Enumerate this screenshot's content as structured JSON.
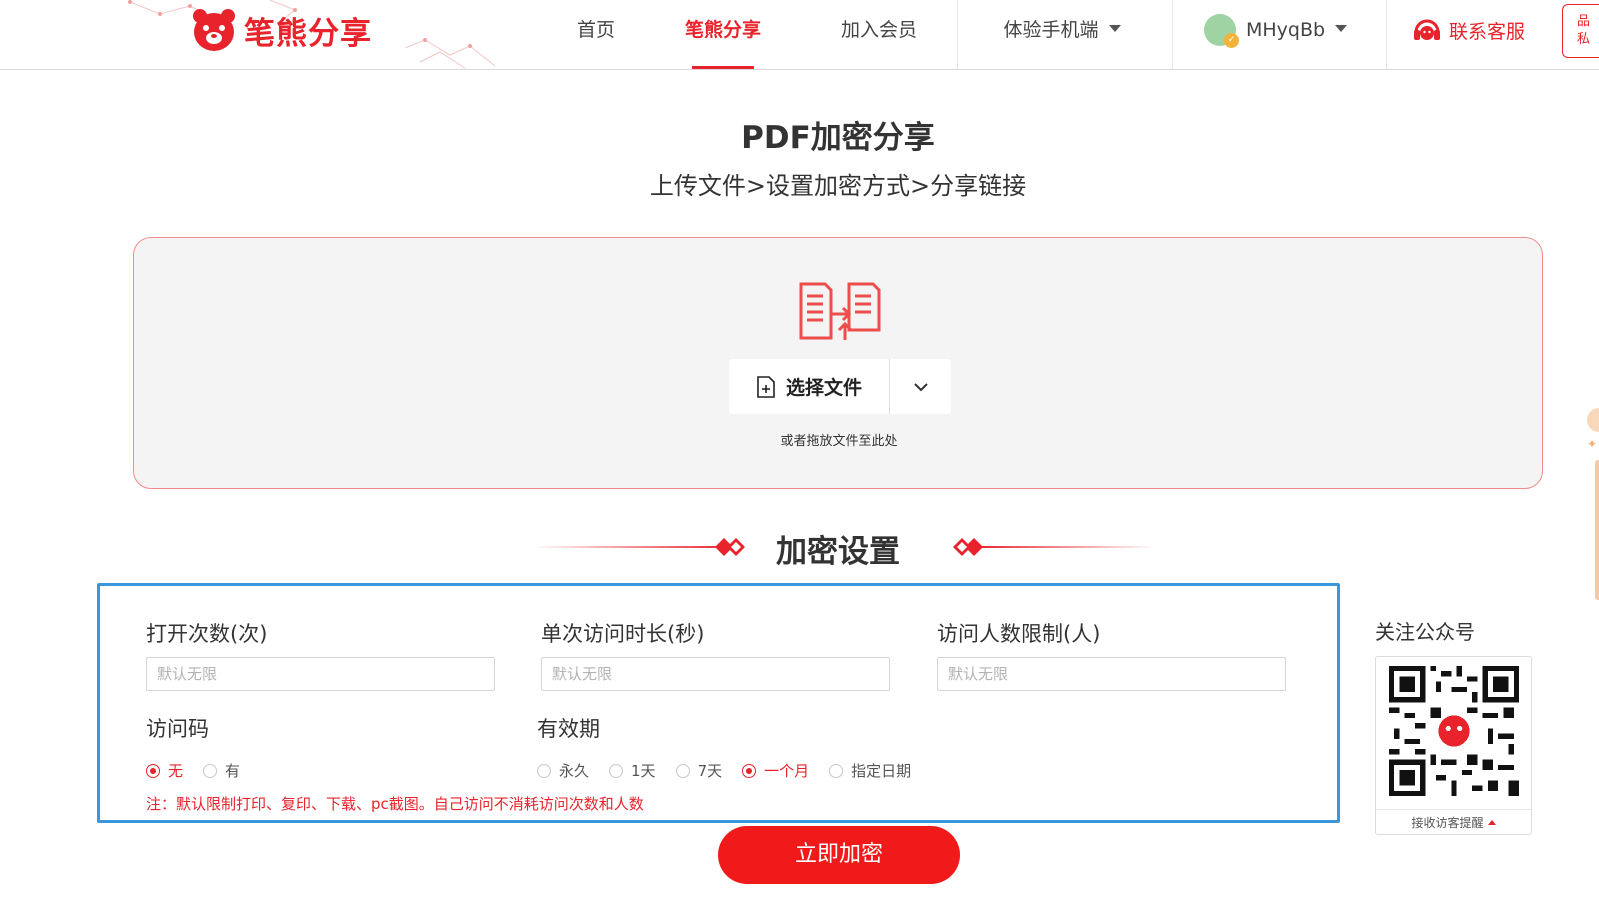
{
  "brand": {
    "name": "笔熊分享",
    "color": "#e8232b"
  },
  "nav": {
    "items": [
      {
        "label": "首页",
        "active": false
      },
      {
        "label": "笔熊分享",
        "active": true
      },
      {
        "label": "加入会员",
        "active": false
      },
      {
        "label": "体验手机端",
        "active": false,
        "dropdown": true
      }
    ],
    "user": {
      "name": "MHyqBb"
    },
    "service": {
      "label": "联系客服"
    },
    "side_tag": {
      "line1": "品",
      "line2": "私"
    }
  },
  "page": {
    "title": "PDF加密分享",
    "subtitle": "上传文件>设置加密方式>分享链接"
  },
  "upload": {
    "select_label": "选择文件",
    "drag_hint": "或者拖放文件至此处"
  },
  "settings": {
    "heading": "加密设置",
    "open_count": {
      "label": "打开次数(次)",
      "placeholder": "默认无限"
    },
    "duration": {
      "label": "单次访问时长(秒)",
      "placeholder": "默认无限"
    },
    "visitor_limit": {
      "label": "访问人数限制(人)",
      "placeholder": "默认无限"
    },
    "access_code": {
      "label": "访问码",
      "options": [
        "无",
        "有"
      ],
      "selected": "无"
    },
    "validity": {
      "label": "有效期",
      "options": [
        "永久",
        "1天",
        "7天",
        "一个月",
        "指定日期"
      ],
      "selected": "一个月"
    },
    "note": "注：默认限制打印、复印、下载、pc截图。自己访问不消耗访问次数和人数"
  },
  "qr": {
    "title": "关注公众号",
    "footer": "接收访客提醒"
  },
  "submit": {
    "label": "立即加密"
  }
}
